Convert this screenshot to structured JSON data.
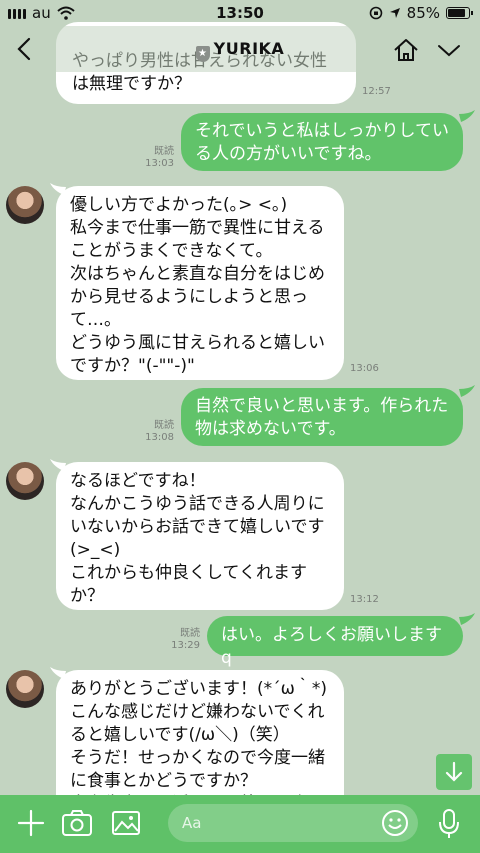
{
  "status": {
    "carrier": "au",
    "time": "13:50",
    "battery": "85%"
  },
  "header": {
    "title": "YURIKA"
  },
  "messages": [
    {
      "side": "in",
      "text": "やっぱり男性は甘えられない女性\nは無理ですか？",
      "time": "12:57"
    },
    {
      "side": "out",
      "text": "それでいうと私はしっかりしてい\nる人の方がいいですね。",
      "read": "既読",
      "time": "13:03"
    },
    {
      "side": "in",
      "text": "優しい方でよかった(｡> <｡)\n私今まで仕事一筋で異性に甘える\nことがうまくできなくて。\n次はちゃんと素直な自分をはじめ\nから見せるようにしようと思っ\nて…。\nどうゆう風に甘えられると嬉しい\nですか？\"(-\"\"-)\"",
      "time": "13:06"
    },
    {
      "side": "out",
      "text": "自然で良いと思います。作られた\n物は求めないです。",
      "read": "既読",
      "time": "13:08"
    },
    {
      "side": "in",
      "text": "なるほどですね！\nなんかこうゆう話できる人周りに\nいないからお話できて嬉しいです\n(>_<)\nこれからも仲良くしてくれます\nか？",
      "time": "13:12"
    },
    {
      "side": "out",
      "text": "はい。よろしくお願いしますq",
      "read": "既読",
      "time": "13:29"
    },
    {
      "side": "in",
      "text": "ありがとうございます！(*´ω｀*)\nこんな感じだけど嫌わないでくれ\nると嬉しいです(/ω＼)（笑）\nそうだ！せっかくなので今度一緒\nに食事とかどうですか？\n当右生卒から近いなら外しい店"
    }
  ],
  "input": {
    "placeholder": "Aa"
  }
}
